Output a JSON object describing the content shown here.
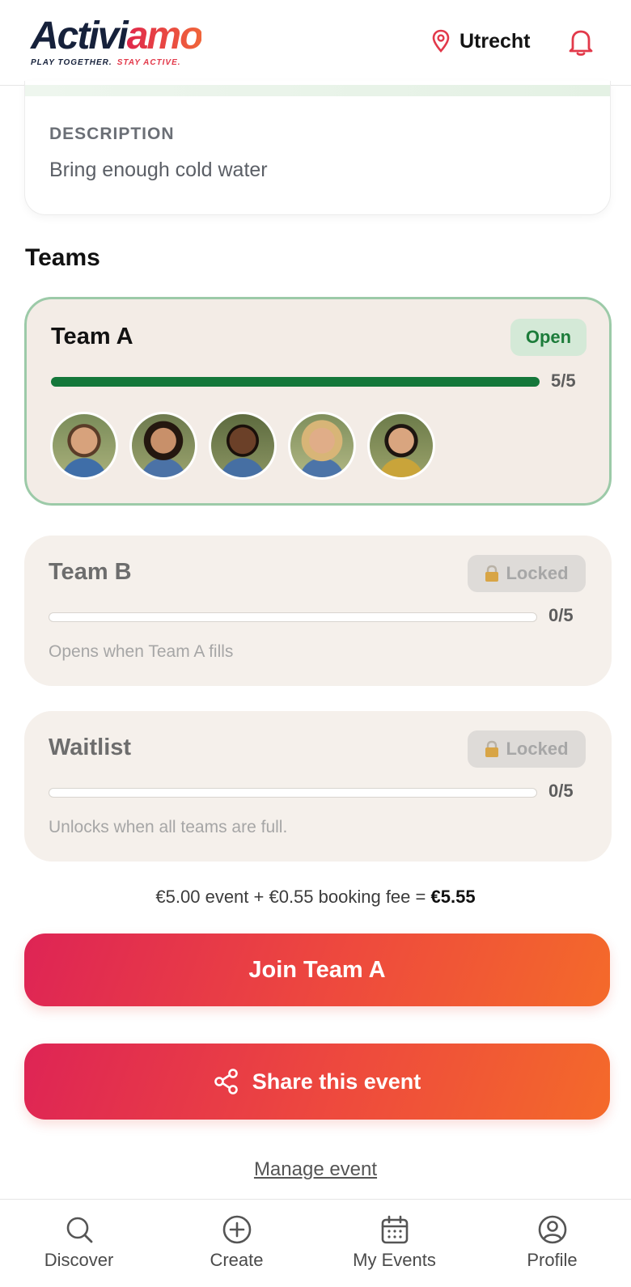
{
  "header": {
    "logo_part1": "Activi",
    "logo_part2": "amo",
    "tagline_part1": "PLAY TOGETHER.",
    "tagline_part2": "STAY ACTIVE.",
    "location": "Utrecht"
  },
  "description": {
    "label": "DESCRIPTION",
    "text": "Bring enough cold water"
  },
  "teams": {
    "title": "Teams",
    "items": [
      {
        "name": "Team A",
        "status": "Open",
        "count": "5/5",
        "filled": 5,
        "capacity": 5
      },
      {
        "name": "Team B",
        "status": "Locked",
        "count": "0/5",
        "filled": 0,
        "capacity": 5,
        "note": "Opens when Team A fills"
      },
      {
        "name": "Waitlist",
        "status": "Locked",
        "count": "0/5",
        "filled": 0,
        "capacity": 5,
        "note": "Unlocks when all teams are full."
      }
    ]
  },
  "pricing": {
    "breakdown": "€5.00 event + €0.55 booking fee =",
    "total": "€5.55"
  },
  "actions": {
    "join_label": "Join Team A",
    "share_label": "Share this event",
    "manage_label": "Manage event"
  },
  "nav": {
    "items": [
      {
        "label": "Discover",
        "icon": "search-icon"
      },
      {
        "label": "Create",
        "icon": "plus-circle-icon"
      },
      {
        "label": "My Events",
        "icon": "calendar-icon"
      },
      {
        "label": "Profile",
        "icon": "user-circle-icon"
      }
    ]
  },
  "colors": {
    "brand_gradient_start": "#de2455",
    "brand_gradient_end": "#f46a2a",
    "open_green": "#14773a"
  }
}
